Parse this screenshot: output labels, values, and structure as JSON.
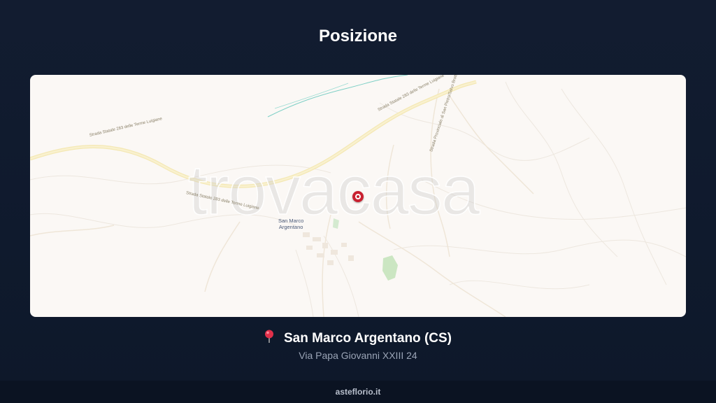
{
  "page": {
    "title": "Posizione"
  },
  "map": {
    "watermark": "trovacasa",
    "town_label_line1": "San Marco",
    "town_label_line2": "Argentano",
    "road_labels": [
      "Strada Statale 283 delle Terme Luigiane",
      "Strada Statale 283 delle Terme Luigiane",
      "Strada Statale 283 delle Terme Luigiane",
      "Strada Provinciale di San Pietro/Salvo Brotto"
    ],
    "pin_icon": "map-marker-icon"
  },
  "location": {
    "icon": "pushpin-icon",
    "city": "San Marco Argentano (CS)",
    "address": "Via Papa Giovanni XXIII 24"
  },
  "footer": {
    "site": "asteflorio.it"
  },
  "colors": {
    "background": "#111b2e",
    "map_background": "#fbf8f5",
    "pin": "#c9202f",
    "road": "#f3e7b0",
    "water": "#3bb6a8",
    "park": "#b7dcae"
  }
}
